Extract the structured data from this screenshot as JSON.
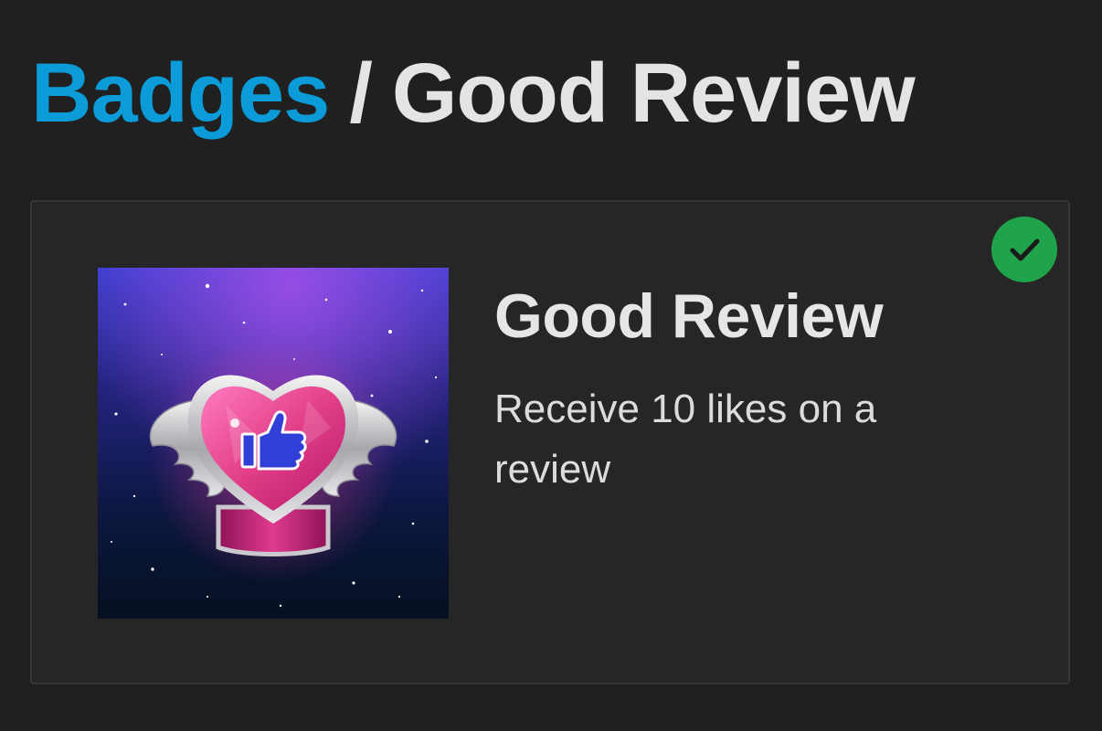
{
  "breadcrumb": {
    "parent_label": "Badges",
    "separator": "/",
    "current_label": "Good Review"
  },
  "badge": {
    "title": "Good Review",
    "description": "Receive 10 likes on a review",
    "earned": true,
    "status_icon": "checkmark-icon",
    "image_icon": "heart-thumbs-up-badge-icon"
  },
  "colors": {
    "background": "#202020",
    "card_background": "#262626",
    "link": "#0a9bd8",
    "earned_badge": "#1fa34b",
    "heart": "#e23f88",
    "thumb": "#2f3fd8"
  }
}
